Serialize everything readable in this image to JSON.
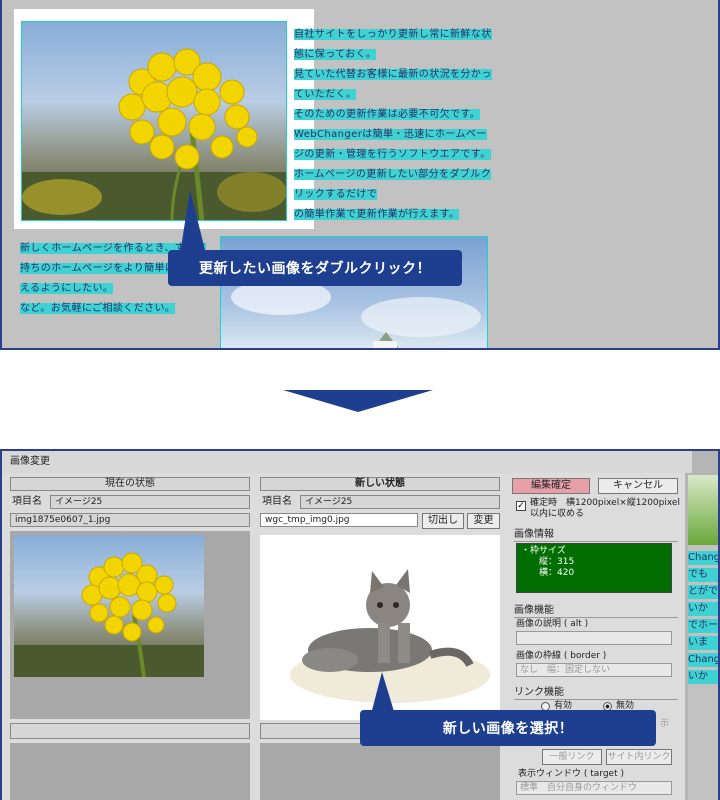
{
  "top": {
    "right_para": [
      "自社サイトをしっかり更新し常に新鮮な状",
      "態に保っておく。",
      "見ていた代替お客様に最新の状況を分かっ",
      "ていただく。",
      "そのための更新作業は必要不可欠です。",
      "WebChangerは簡単・迅速にホームペー",
      "ジの更新・管理を行うソフトウエアです。",
      "ホームページの更新したい部分をダブルク",
      "リックするだけで",
      "の簡単作業で更新作業が行えます。"
    ],
    "left_para": [
      "新しくホームページを作るとき、すでに",
      "持ちのホームページをより簡単に",
      "えるようにしたい。",
      "など。お気軽にご相談ください。"
    ],
    "callout": "更新したい画像をダブルクリック！"
  },
  "dialog": {
    "title": "画像変更",
    "current": {
      "header": "現在の状態",
      "item_label": "項目名",
      "item_value": "イメージ25",
      "filename": "img1875e0607_1.jpg"
    },
    "new": {
      "header": "新しい状態",
      "item_label": "項目名",
      "item_value": "イメージ25",
      "filename": "wgc_tmp_img0.jpg",
      "cut_button": "切出し",
      "change_button": "変更"
    },
    "right": {
      "confirm_button": "編集確定",
      "cancel_button": "キャンセル",
      "checkbox_label_1": "確定時　横1200pixel×縦1200pixel",
      "checkbox_label_2": "以内に収める",
      "image_info_title": "画像情報",
      "image_info_text": "・枠サイズ\n　　縦：315\n　　横：420",
      "image_function_title": "画像機能",
      "alt_label": "画像の説明 ( alt )",
      "border_label": "画像の枠線 ( border )",
      "border_value": "なし　幅：固定しない",
      "link_function_title": "リンク機能",
      "radio_on": "有効",
      "radio_off": "無効",
      "general_link": "一般リンク",
      "site_link": "サイト内リンク",
      "window_label": "表示ウィンドウ ( target )",
      "window_value": "標準　自分自身のウィンドウ",
      "faded_char": "示"
    },
    "callout": "新しい画像を選択！"
  },
  "edge_text": [
    "Chang",
    "でも",
    "とがで",
    "いか",
    "でホー",
    "いま",
    "Chang",
    "いか"
  ],
  "colors": {
    "accent": "#1e3f8f",
    "highlight": "#3fd2d2",
    "info_bg": "#006d00"
  }
}
